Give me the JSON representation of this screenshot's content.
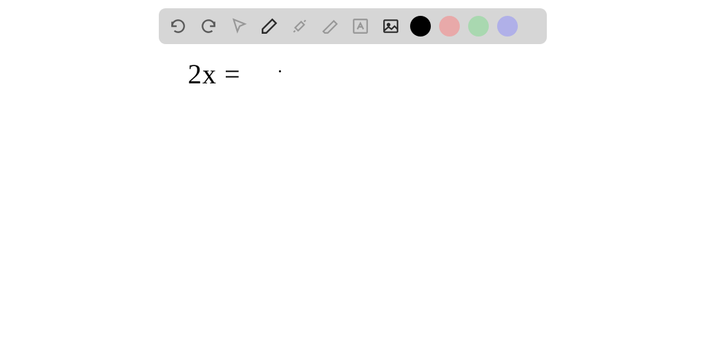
{
  "toolbar": {
    "undo": "undo",
    "redo": "redo",
    "cursor": "cursor",
    "pen": "pen",
    "tools": "tools",
    "eraser": "eraser",
    "text": "text",
    "image": "image"
  },
  "colors": {
    "black": "#000000",
    "pink": "#e8a9a9",
    "green": "#a9d8b0",
    "purple": "#b0b0e8"
  },
  "canvas": {
    "expression": "2x ="
  }
}
